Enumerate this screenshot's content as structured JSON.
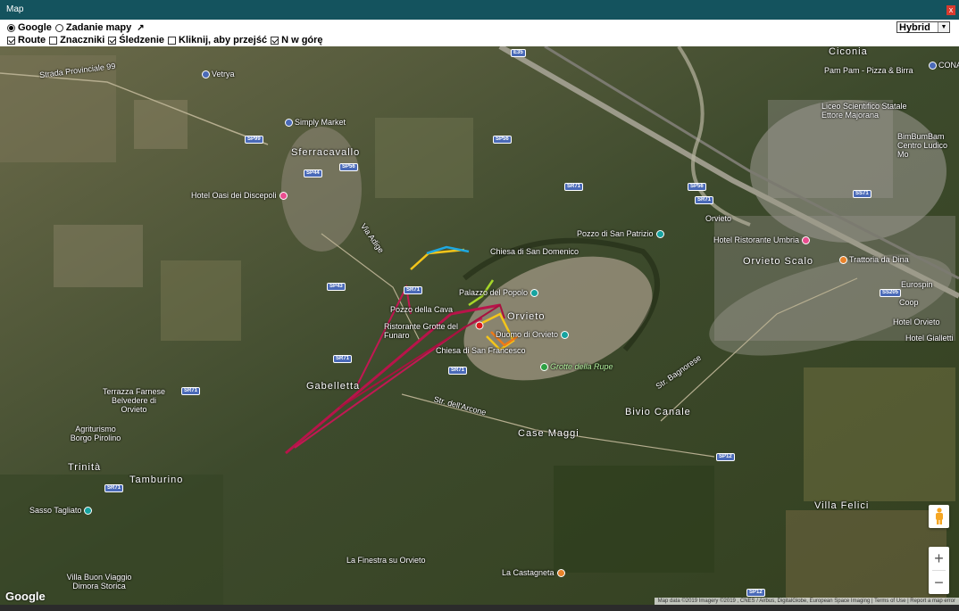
{
  "window": {
    "title": "Map",
    "close_label": "x"
  },
  "toolbar": {
    "source_google": "Google",
    "source_task": "Zadanie mapy",
    "ext_icon": "↗",
    "map_type": "Hybrid",
    "route": "Route",
    "markers": "Znaczniki",
    "tracking": "Śledzenie",
    "click_to_go": "Kliknij, aby przejść",
    "north_up": "N w górę"
  },
  "map": {
    "google_logo": "Google",
    "attribution": "Map data ©2019 Imagery ©2019 , CNES / Airbus, DigitalGlobe, European Space Imaging | Terms of Use | Report a map error",
    "zoom_in": "+",
    "zoom_out": "−",
    "places": {
      "vetrya": "Vetrya",
      "strada_provinciale": "Strada Provinciale 99",
      "simply_market": "Simply Market",
      "sferracavallo": "Sferracavallo",
      "hotel_oasi": "Hotel Oasi dei Discepoli",
      "chiesa_domenico": "Chiesa di San Domenico",
      "pozzo_patrizio": "Pozzo di San Patrizio",
      "orvieto_station": "Orvieto",
      "hotel_umbria": "Hotel Ristorante Umbria",
      "orvieto_scalo": "Orvieto Scalo",
      "trattoria_dina": "Trattoria da Dina",
      "palazzo_popolo": "Palazzo del Popolo",
      "pozzo_cava": "Pozzo della Cava",
      "orvieto": "Orvieto",
      "ristorante_grotte": "Ristorante Grotte del Funaro",
      "duomo": "Duomo di Orvieto",
      "chiesa_francesco": "Chiesa di San Francesco",
      "grotte_rupe": "Grotte della Rupe",
      "terrazza_farnese": "Terrazza Farnese Belvedere di Orvieto",
      "agriturismo": "Agriturismo Borgo Pirolino",
      "trinita": "Trinità",
      "tamburino": "Tamburino",
      "sasso_tagliato": "Sasso Tagliato",
      "villa_buon_viaggio": "Villa Buon Viaggio Dimora Storica",
      "finestra_orvieto": "La Finestra su Orvieto",
      "la_castagneta": "La Castagneta",
      "bivio_canale": "Bivio Canale",
      "case_maggi": "Case Maggi",
      "villa_felici": "Villa Felici",
      "gabelletta": "Gabelletta",
      "pam_pam": "Pam Pam - Pizza & Birra",
      "liceo": "Liceo Scientifico Statale Ettore Majorana",
      "bim_bum_bam": "BimBumBam Centro Ludico Mo",
      "eurospin": "Eurospin",
      "coop": "Coop",
      "hotel_orvieto": "Hotel Orvieto",
      "hotel_gialletti": "Hotel Gialletti",
      "conad": "CONA",
      "ciconia": "Ciconia",
      "str_arcone": "Str. dell'Arcone",
      "str_bagnoregio": "Str. Bagnorese",
      "via_adige": "Via Adige"
    },
    "roads": [
      "SP99",
      "SP56",
      "SP44",
      "SP56",
      "SP43",
      "SR71",
      "SR71",
      "SR71",
      "SR71",
      "SR71",
      "SP56",
      "SR71",
      "SR71",
      "SS71",
      "SS205",
      "SP12",
      "SP12",
      "E35"
    ]
  }
}
